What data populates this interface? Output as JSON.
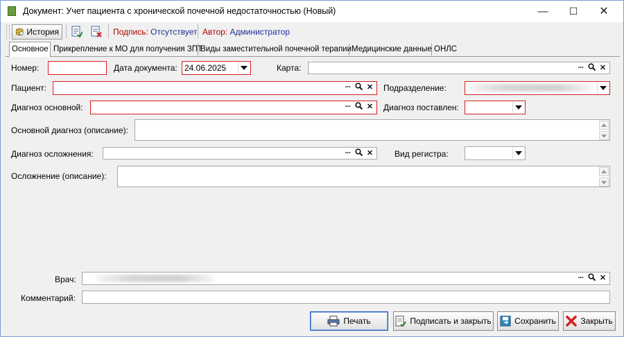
{
  "window": {
    "title": "Документ: Учет пациента с хронической почечной недостаточностью (Новый)",
    "minimize": "—",
    "maximize": "☐",
    "close": "✕"
  },
  "toolbar": {
    "history_label": "История",
    "signature_label": "Подпись:",
    "signature_value": "Отсутствует",
    "author_label": "Автор:",
    "author_value": "Администратор"
  },
  "tabs": [
    {
      "label": "Основное"
    },
    {
      "label": "Прикрепление к МО для получения ЗПТ"
    },
    {
      "label": "Виды заместительной почечной терапии"
    },
    {
      "label": "Медицинские данные"
    },
    {
      "label": "ОНЛС"
    }
  ],
  "form": {
    "number_label": "Номер:",
    "number_value": "",
    "doc_date_label": "Дата документа:",
    "doc_date_value": "24.06.2025",
    "card_label": "Карта:",
    "card_value": "",
    "patient_label": "Пациент:",
    "patient_value": "",
    "subdivision_label": "Подразделение:",
    "main_diag_label": "Диагноз основной:",
    "main_diag_value": "",
    "diag_set_label": "Диагноз поставлен:",
    "main_diag_desc_label": "Основной диагноз (описание):",
    "complication_diag_label": "Диагноз осложнения:",
    "registry_type_label": "Вид регистра:",
    "complication_desc_label": "Осложнение (описание):",
    "doctor_label": "Врач:",
    "comment_label": "Комментарий:",
    "comment_value": ""
  },
  "icons": {
    "dots": "···",
    "search": "🔍",
    "clear": "✕"
  },
  "buttons": {
    "print": "Печать",
    "sign_close": "Подписать и закрыть",
    "save": "Сохранить",
    "close": "Закрыть"
  },
  "colors": {
    "required_border": "#d42020",
    "signature_label": "#b00000",
    "author_value": "#1f2f98"
  }
}
